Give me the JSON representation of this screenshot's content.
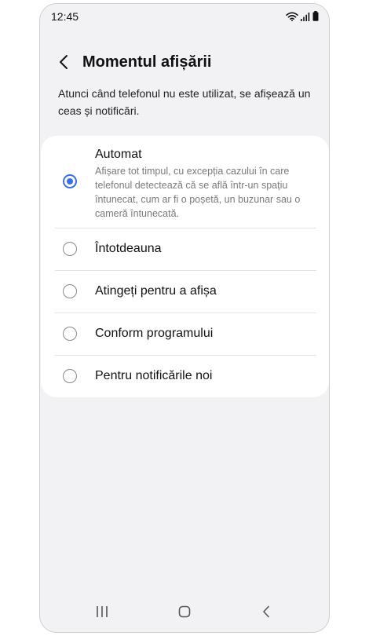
{
  "status_bar": {
    "time": "12:45",
    "icons": [
      "wifi-icon",
      "signal-icon",
      "battery-icon"
    ]
  },
  "header": {
    "back_icon": "chevron-left-icon",
    "title": "Momentul afișării"
  },
  "description": "Atunci când telefonul nu este utilizat, se afișează un ceas și notificări.",
  "options": [
    {
      "label": "Automat",
      "description": "Afișare tot timpul, cu excepția cazului în care telefonul detectează că se află într-un spațiu întunecat, cum ar fi o poșetă, un buzunar sau o cameră întunecată.",
      "selected": true
    },
    {
      "label": "Întotdeauna",
      "selected": false
    },
    {
      "label": "Atingeți pentru a afișa",
      "selected": false
    },
    {
      "label": "Conform programului",
      "selected": false
    },
    {
      "label": "Pentru notificările noi",
      "selected": false
    }
  ],
  "nav_bar": {
    "icons": [
      "recent-apps-icon",
      "home-icon",
      "back-icon"
    ]
  },
  "colors": {
    "accent": "#3a6ee8",
    "background": "#f2f2f4",
    "card": "#ffffff"
  }
}
